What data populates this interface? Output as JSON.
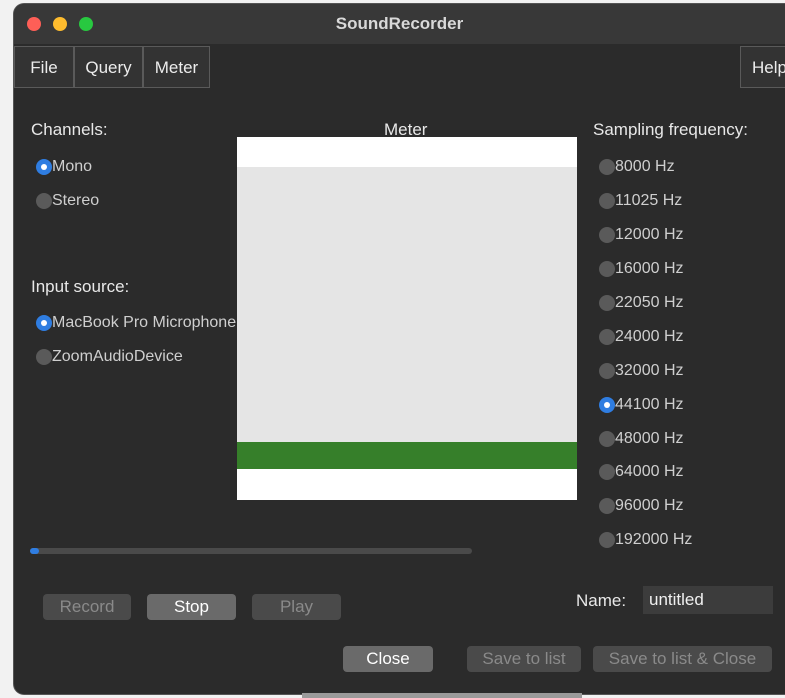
{
  "window": {
    "title": "SoundRecorder",
    "traffic_colors": {
      "close": "#fe5f57",
      "minimize": "#febc2e",
      "zoom": "#28c840"
    }
  },
  "menu": {
    "file": "File",
    "query": "Query",
    "meter": "Meter",
    "help": "Help"
  },
  "channels": {
    "label": "Channels:",
    "options": [
      {
        "label": "Mono",
        "selected": true
      },
      {
        "label": "Stereo",
        "selected": false
      }
    ]
  },
  "input_source": {
    "label": "Input source:",
    "options": [
      {
        "label": "MacBook Pro Microphone",
        "selected": true
      },
      {
        "label": "ZoomAudioDevice",
        "selected": false
      }
    ]
  },
  "meter": {
    "label": "Meter",
    "colors": {
      "background": "#ffffff",
      "panel": "#e5e5e5",
      "level": "#367f2a"
    }
  },
  "sampling": {
    "label": "Sampling frequency:",
    "options": [
      {
        "label": "8000 Hz",
        "selected": false
      },
      {
        "label": "11025 Hz",
        "selected": false
      },
      {
        "label": "12000 Hz",
        "selected": false
      },
      {
        "label": "16000 Hz",
        "selected": false
      },
      {
        "label": "22050 Hz",
        "selected": false
      },
      {
        "label": "24000 Hz",
        "selected": false
      },
      {
        "label": "32000 Hz",
        "selected": false
      },
      {
        "label": "44100 Hz",
        "selected": true
      },
      {
        "label": "48000 Hz",
        "selected": false
      },
      {
        "label": "64000 Hz",
        "selected": false
      },
      {
        "label": "96000 Hz",
        "selected": false
      },
      {
        "label": "192000 Hz",
        "selected": false
      }
    ]
  },
  "progress": {
    "fraction": 0.02,
    "color": "#2f7de1"
  },
  "controls": {
    "record": "Record",
    "stop": "Stop",
    "play": "Play"
  },
  "name_field": {
    "label": "Name:",
    "value": "untitled"
  },
  "actions": {
    "close": "Close",
    "save_to_list": "Save to list",
    "save_to_list_close": "Save to list & Close"
  }
}
